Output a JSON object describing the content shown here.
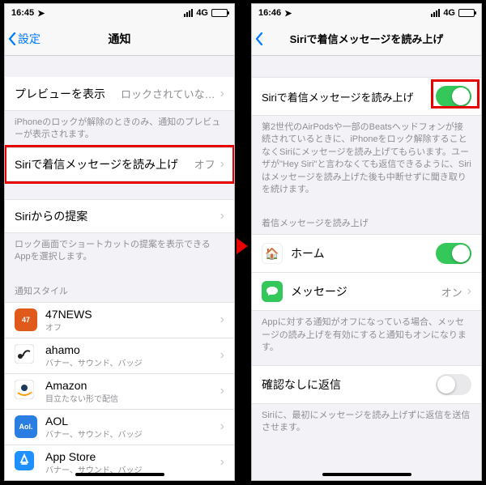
{
  "left": {
    "status": {
      "time": "16:45",
      "network": "4G"
    },
    "nav": {
      "back": "設定",
      "title": "通知"
    },
    "preview": {
      "label": "プレビューを表示",
      "value": "ロックされていな…"
    },
    "preview_footer": "iPhoneのロックが解除のときのみ、通知のプレビューが表示されます。",
    "siri_row": {
      "label": "Siriで着信メッセージを読み上げ",
      "value": "オフ"
    },
    "suggestions": {
      "label": "Siriからの提案"
    },
    "suggestions_footer": "ロック画面でショートカットの提案を表示できるAppを選択します。",
    "style_header": "通知スタイル",
    "apps": [
      {
        "name": "47NEWS",
        "sub": "オフ",
        "color": "#e05a1c",
        "badge": "47"
      },
      {
        "name": "ahamo",
        "sub": "バナー、サウンド、バッジ",
        "color": "#ffffff",
        "badge": ""
      },
      {
        "name": "Amazon",
        "sub": "目立たない形で配信",
        "color": "#ffffff",
        "badge": ""
      },
      {
        "name": "AOL",
        "sub": "バナー、サウンド、バッジ",
        "color": "#2a7de1",
        "badge": "Aol."
      },
      {
        "name": "App Store",
        "sub": "バナー、サウンド、バッジ",
        "color": "#1e90ff",
        "badge": "A"
      }
    ]
  },
  "right": {
    "status": {
      "time": "16:46",
      "network": "4G"
    },
    "nav": {
      "title": "Siriで着信メッセージを読み上げ"
    },
    "toggle": {
      "label": "Siriで着信メッセージを読み上げ"
    },
    "toggle_footer": "第2世代のAirPodsや一部のBeatsヘッドフォンが接続されているときに、iPhoneをロック解除することなくSiriにメッセージを読み上げてもらいます。ユーザが\"Hey Siri\"と言わなくても返信できるように、Siriはメッセージを読み上げた後も中断せずに聞き取りを続けます。",
    "apps_header": "着信メッセージを読み上げ",
    "apps": [
      {
        "name": "ホーム",
        "color": "#fff",
        "type": "toggle"
      },
      {
        "name": "メッセージ",
        "value": "オン",
        "color": "#34c759",
        "type": "nav"
      }
    ],
    "apps_footer": "Appに対する通知がオフになっている場合、メッセージの読み上げを有効にすると通知もオンになります。",
    "reply": {
      "label": "確認なしに返信"
    },
    "reply_footer": "Siriに、最初にメッセージを読み上げずに返信を送信させます。"
  }
}
